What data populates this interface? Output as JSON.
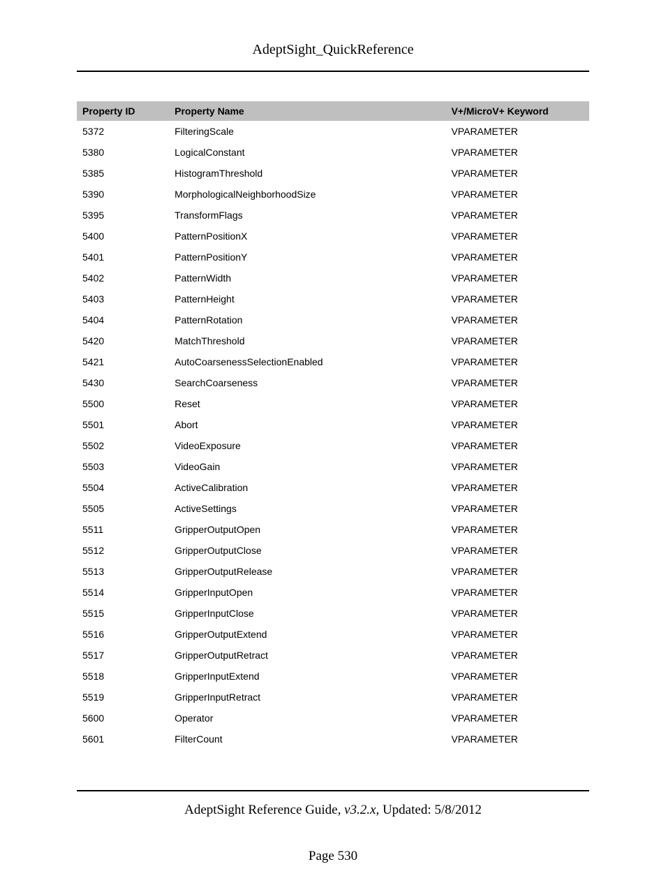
{
  "header": {
    "title": "AdeptSight_QuickReference"
  },
  "table": {
    "columns": {
      "id": "Property ID",
      "name": "Property Name",
      "keyword": "V+/MicroV+ Keyword"
    },
    "rows": [
      {
        "id": "5372",
        "name": "FilteringScale",
        "keyword": "VPARAMETER"
      },
      {
        "id": "5380",
        "name": "LogicalConstant",
        "keyword": "VPARAMETER"
      },
      {
        "id": "5385",
        "name": "HistogramThreshold",
        "keyword": "VPARAMETER"
      },
      {
        "id": "5390",
        "name": "MorphologicalNeighborhoodSize",
        "keyword": "VPARAMETER"
      },
      {
        "id": "5395",
        "name": "TransformFlags",
        "keyword": "VPARAMETER"
      },
      {
        "id": "5400",
        "name": "PatternPositionX",
        "keyword": "VPARAMETER"
      },
      {
        "id": "5401",
        "name": "PatternPositionY",
        "keyword": "VPARAMETER"
      },
      {
        "id": "5402",
        "name": "PatternWidth",
        "keyword": "VPARAMETER"
      },
      {
        "id": "5403",
        "name": "PatternHeight",
        "keyword": "VPARAMETER"
      },
      {
        "id": "5404",
        "name": "PatternRotation",
        "keyword": "VPARAMETER"
      },
      {
        "id": "5420",
        "name": "MatchThreshold",
        "keyword": "VPARAMETER"
      },
      {
        "id": "5421",
        "name": "AutoCoarsenessSelectionEnabled",
        "keyword": "VPARAMETER"
      },
      {
        "id": "5430",
        "name": "SearchCoarseness",
        "keyword": "VPARAMETER"
      },
      {
        "id": "5500",
        "name": "Reset",
        "keyword": "VPARAMETER"
      },
      {
        "id": "5501",
        "name": "Abort",
        "keyword": "VPARAMETER"
      },
      {
        "id": "5502",
        "name": "VideoExposure",
        "keyword": "VPARAMETER"
      },
      {
        "id": "5503",
        "name": "VideoGain",
        "keyword": "VPARAMETER"
      },
      {
        "id": "5504",
        "name": "ActiveCalibration",
        "keyword": "VPARAMETER"
      },
      {
        "id": "5505",
        "name": "ActiveSettings",
        "keyword": "VPARAMETER"
      },
      {
        "id": "5511",
        "name": "GripperOutputOpen",
        "keyword": "VPARAMETER"
      },
      {
        "id": "5512",
        "name": "GripperOutputClose",
        "keyword": "VPARAMETER"
      },
      {
        "id": "5513",
        "name": "GripperOutputRelease",
        "keyword": "VPARAMETER"
      },
      {
        "id": "5514",
        "name": "GripperInputOpen",
        "keyword": "VPARAMETER"
      },
      {
        "id": "5515",
        "name": "GripperInputClose",
        "keyword": "VPARAMETER"
      },
      {
        "id": "5516",
        "name": "GripperOutputExtend",
        "keyword": "VPARAMETER"
      },
      {
        "id": "5517",
        "name": "GripperOutputRetract",
        "keyword": "VPARAMETER"
      },
      {
        "id": "5518",
        "name": "GripperInputExtend",
        "keyword": "VPARAMETER"
      },
      {
        "id": "5519",
        "name": "GripperInputRetract",
        "keyword": "VPARAMETER"
      },
      {
        "id": "5600",
        "name": "Operator",
        "keyword": "VPARAMETER"
      },
      {
        "id": "5601",
        "name": "FilterCount",
        "keyword": "VPARAMETER"
      }
    ]
  },
  "footer": {
    "guide_prefix": "AdeptSight Reference Guide",
    "version": ", v3.2.x",
    "updated": ", Updated: 5/8/2012",
    "page": "Page 530"
  }
}
